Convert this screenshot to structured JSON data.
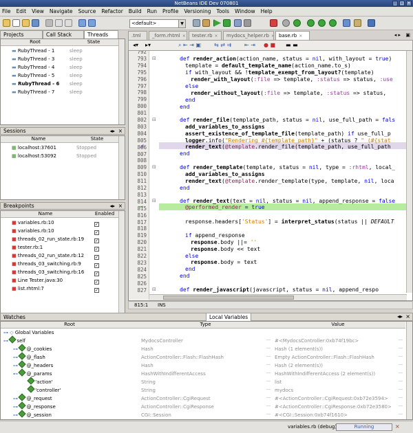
{
  "window": {
    "title": "NetBeans IDE Dev 070801"
  },
  "menu": [
    "File",
    "Edit",
    "View",
    "Navigate",
    "Source",
    "Refactor",
    "Build",
    "Run",
    "Profile",
    "Versioning",
    "Tools",
    "Window",
    "Help"
  ],
  "toolbar": {
    "config_value": "<default>"
  },
  "threads_panel": {
    "tabs": [
      "Projects",
      "Call Stack",
      "Threads"
    ],
    "columns": [
      "Root",
      "State"
    ],
    "rows": [
      {
        "name": "RubyThread - 1",
        "state": "sleep"
      },
      {
        "name": "RubyThread - 3",
        "state": "sleep"
      },
      {
        "name": "RubyThread - 4",
        "state": "sleep"
      },
      {
        "name": "RubyThread - 5",
        "state": "sleep"
      },
      {
        "name": "RubyThread - 6",
        "state": "sleep"
      },
      {
        "name": "RubyThread - 7",
        "state": "sleep"
      }
    ]
  },
  "sessions_panel": {
    "title": "Sessions",
    "columns": [
      "Name",
      "State"
    ],
    "rows": [
      {
        "name": "localhost:37601",
        "state": "Stopped"
      },
      {
        "name": "localhost:53092",
        "state": "Stopped"
      }
    ]
  },
  "breakpoints_panel": {
    "title": "Breakpoints",
    "columns": [
      "Name",
      "Enabled"
    ],
    "rows": [
      "variables.rb:10",
      "variables.rb:10",
      "threads_02_run_state.rb:19",
      "tester.rb:1",
      "threads_02_run_state.rb:12",
      "threads_03_switching.rb:9",
      "threads_03_switching.rb:16",
      "Line Tester.java:30",
      "list.rhtml:7"
    ]
  },
  "editor": {
    "tabs": [
      ".tml",
      "_form.rhtml",
      "tester.rb",
      "mydocs_helper.rb",
      "base.rb"
    ],
    "line_numbers": [
      "792",
      "793",
      "794",
      "795",
      "796",
      "797",
      "798",
      "799",
      "800",
      "801",
      "802",
      "803",
      "804",
      "805",
      "806",
      "807",
      "808",
      "809",
      "810",
      "811",
      "812",
      "813",
      "814",
      "815",
      "816",
      "817",
      "818",
      "819",
      "820",
      "821",
      "822",
      "823",
      "824",
      "825",
      "826",
      "827"
    ],
    "caret_pos": "815:1",
    "ins_mode": "INS"
  },
  "watches_panel": {
    "tabs": [
      "Watches",
      "Local Variables"
    ],
    "columns": [
      "Root",
      "Type",
      "Value"
    ],
    "rows": [
      {
        "name": "Global Variables",
        "type": "",
        "value": ""
      },
      {
        "name": "self",
        "type": "MydocsController",
        "value": "#<MydocsController:0xb74f19bc>"
      },
      {
        "name": "@_cookies",
        "type": "Hash",
        "value": "Hash (1 element(s))"
      },
      {
        "name": "@_flash",
        "type": "ActionController::Flash::FlashHash",
        "value": "Empty ActionController::Flash::FlashHash"
      },
      {
        "name": "@_headers",
        "type": "Hash",
        "value": "Hash (2 element(s))"
      },
      {
        "name": "@_params",
        "type": "HashWithIndifferentAccess",
        "value": "HashWithIndifferentAccess (2 element(s))"
      },
      {
        "name": "'action'",
        "type": "String",
        "value": "list"
      },
      {
        "name": "'controller'",
        "type": "String",
        "value": "mydocs"
      },
      {
        "name": "@_request",
        "type": "ActionController::CgiRequest",
        "value": "#<ActionController::CgiRequest:0xb72e3594>"
      },
      {
        "name": "@_response",
        "type": "ActionController::CgiResponse",
        "value": "#<ActionController::CgiResponse:0xb72e3580>"
      },
      {
        "name": "@_session",
        "type": "CGI::Session",
        "value": "#<CGI::Session:0xb74f1610>"
      }
    ]
  },
  "status": {
    "file": "variables.rb (debug)",
    "state": "Running"
  },
  "colors": {
    "current_line": "#b7ec9f",
    "breakpoint_line": "#e0d8ea",
    "title_bg": "#2f4f8a"
  }
}
